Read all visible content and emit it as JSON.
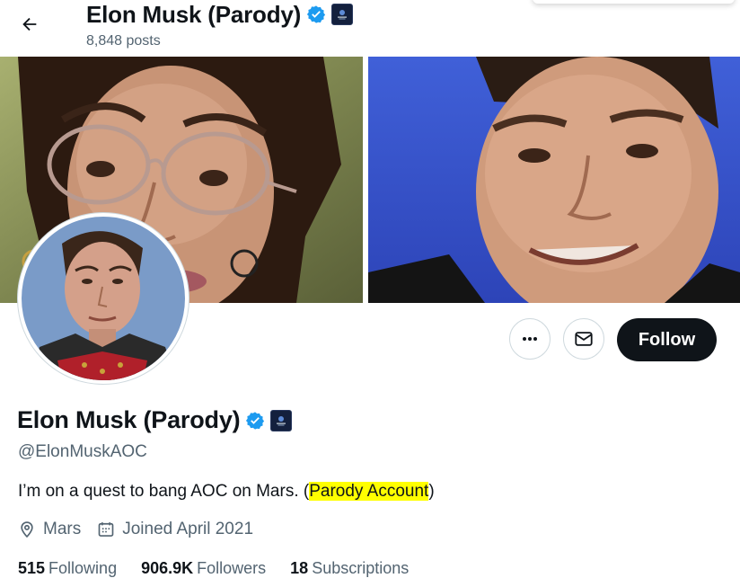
{
  "header": {
    "title": "Elon Musk (Parody)",
    "posts": "8,848 posts",
    "back_icon": "arrow-left-icon"
  },
  "profile": {
    "name": "Elon Musk (Parody)",
    "handle": "@ElonMuskAOC",
    "bio_before": "I’m on a quest to bang AOC on Mars. (",
    "bio_highlight": "Parody Account",
    "bio_after": ")",
    "location": "Mars",
    "joined": "Joined April 2021",
    "verified_color": "#1d9bf0",
    "highlight_color": "#ffff00"
  },
  "actions": {
    "more_icon": "more-dots-icon",
    "message_icon": "envelope-icon",
    "follow_label": "Follow"
  },
  "stats": [
    {
      "count": "515",
      "label": "Following"
    },
    {
      "count": "906.9K",
      "label": "Followers"
    },
    {
      "count": "18",
      "label": "Subscriptions"
    }
  ]
}
